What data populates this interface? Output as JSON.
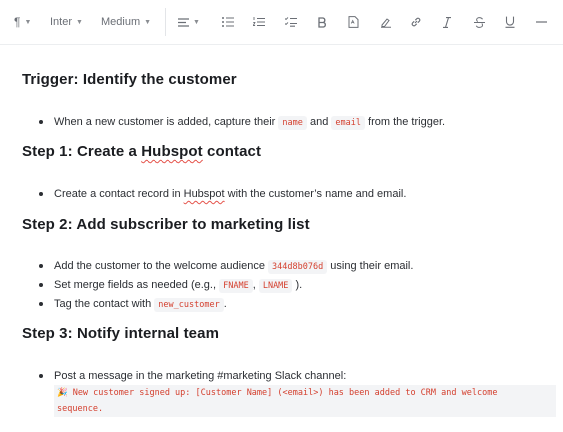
{
  "toolbar": {
    "paragraph_icon": "paragraph-icon",
    "font_family": "Inter",
    "font_weight": "Medium",
    "align_icon": "align-left-icon",
    "tools": [
      "bullet-list-icon",
      "ordered-list-icon",
      "checklist-icon",
      "bold-icon",
      "file-icon",
      "highlight-icon",
      "link-icon",
      "italic-icon",
      "strikethrough-icon",
      "underline-icon",
      "horizontal-rule-icon"
    ]
  },
  "doc": {
    "trigger": {
      "title": "Trigger: Identify the customer",
      "item": {
        "pre": "When a new customer is added, capture their",
        "code1": "name",
        "mid": "and",
        "code2": "email",
        "post": "from the trigger."
      }
    },
    "step1": {
      "title_pre": "Step 1: Create a ",
      "title_spell": "Hubspot",
      "title_post": " contact",
      "item": {
        "pre": "Create a contact record in ",
        "spell": "Hubspot",
        "post": " with the customer’s name and email."
      }
    },
    "step2": {
      "title": "Step 2: Add subscriber to marketing list",
      "item1": {
        "pre": "Add the customer to the welcome audience",
        "code": "344d8b076d",
        "post": "using their email."
      },
      "item2": {
        "pre": "Set merge fields as needed (e.g.,",
        "code1": "FNAME",
        "sep": ",",
        "code2": "LNAME",
        "post": ")."
      },
      "item3": {
        "pre": "Tag the contact with",
        "code": "new_customer",
        "post": "."
      }
    },
    "step3": {
      "title": "Step 3: Notify internal team",
      "item": {
        "text": "Post a message in the marketing #marketing Slack channel:"
      },
      "code_line1": "🎉 New customer signed up: [Customer Name] (<email>) has been added to CRM and welcome",
      "code_line2": "sequence."
    }
  },
  "colors": {
    "code_text": "#d4402f",
    "code_bg": "#f3f4f6",
    "spell_underline": "#e5534b"
  }
}
